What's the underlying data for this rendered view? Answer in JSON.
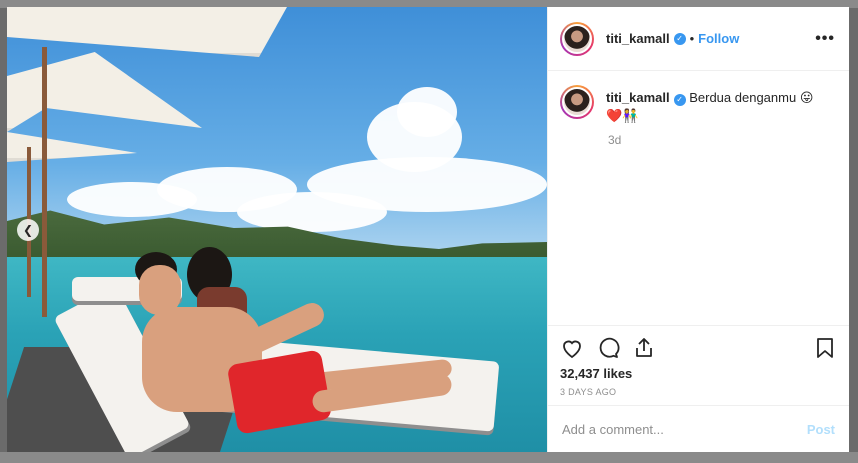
{
  "post": {
    "username": "titi_kamall",
    "verified": true,
    "follow_label": "Follow",
    "more_icon": "more-options-icon",
    "caption": "Berdua denganmu",
    "caption_emoji_1": "😛",
    "caption_emoji_2": "❤️👫",
    "relative_time": "3d",
    "likes": "32,437 likes",
    "date": "3 DAYS AGO",
    "comment_placeholder": "Add a comment...",
    "post_label": "Post"
  },
  "icons": {
    "like": "heart-icon",
    "comment": "comment-icon",
    "share": "share-icon",
    "save": "bookmark-icon",
    "prev": "chevron-left-icon"
  },
  "colors": {
    "accent": "#3897f0",
    "post_disabled": "#b2dffc",
    "muted": "#8e8e8e"
  }
}
